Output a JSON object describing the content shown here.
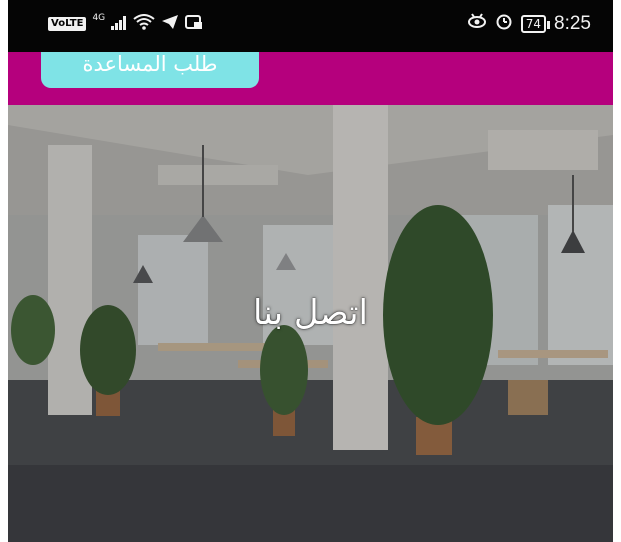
{
  "status_bar": {
    "volte": "VoLTE",
    "network": "4G",
    "battery": "74",
    "time": "8:25",
    "icons": [
      "signal-icon",
      "wifi-icon",
      "telegram-icon",
      "app-notification-icon",
      "eye-icon",
      "alarm-icon"
    ]
  },
  "header": {
    "background": "#b5007d",
    "help_button_label": "طلب المساعدة",
    "help_button_color": "#7fe3e6"
  },
  "hero": {
    "title": "اتصل بنا",
    "image_description": "open-plan office"
  }
}
